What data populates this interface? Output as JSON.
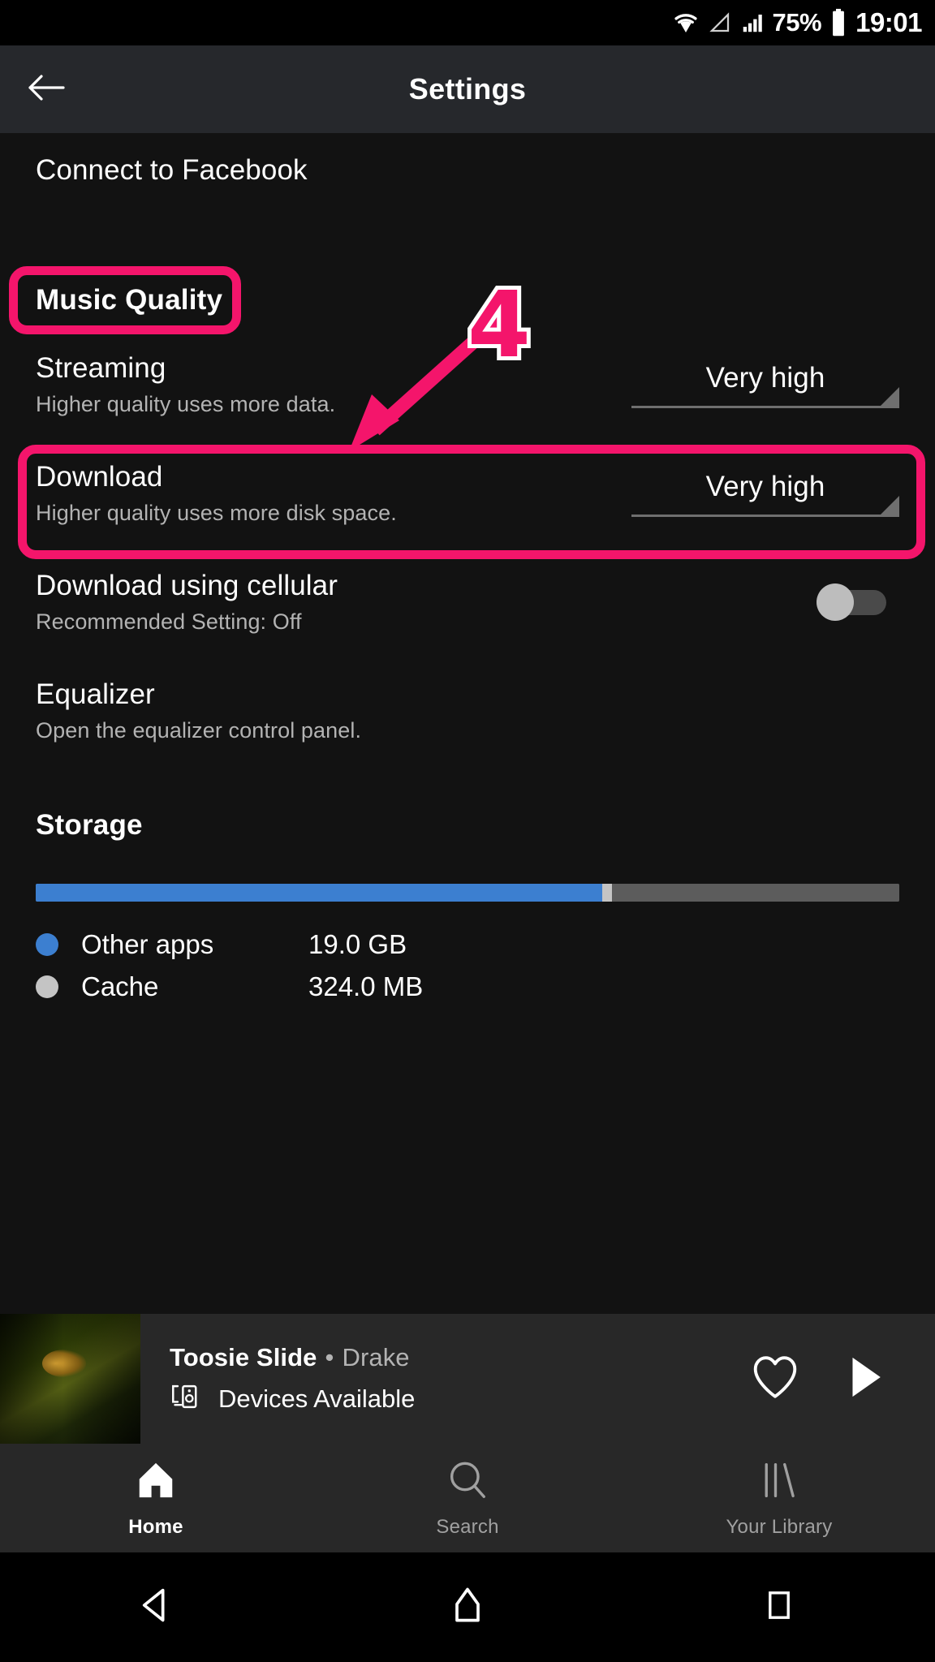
{
  "status_bar": {
    "wifi_icon": "wifi-icon",
    "signal_triangle_icon": "signal-triangle-icon",
    "signal_bars_icon": "signal-bars-icon",
    "battery_percent": "75%",
    "battery_icon": "battery-icon",
    "clock": "19:01"
  },
  "app_bar": {
    "back_icon": "back-arrow-icon",
    "title": "Settings"
  },
  "settings": {
    "facebook": {
      "title": "Connect to Facebook"
    },
    "music_quality_header": "Music Quality",
    "streaming": {
      "title": "Streaming",
      "subtitle": "Higher quality uses more data.",
      "value": "Very high"
    },
    "download": {
      "title": "Download",
      "subtitle": "Higher quality uses more disk space.",
      "value": "Very high"
    },
    "download_cellular": {
      "title": "Download using cellular",
      "subtitle": "Recommended Setting: Off",
      "toggle_state": "off"
    },
    "equalizer": {
      "title": "Equalizer",
      "subtitle": "Open the equalizer control panel."
    },
    "storage_header": "Storage"
  },
  "storage": {
    "bar_segments": [
      {
        "name": "Other apps",
        "percent": 65.6,
        "color": "#3C7FD0"
      },
      {
        "name": "Cache",
        "percent": 1.1,
        "color": "#C4C4C4"
      },
      {
        "name": "Free",
        "percent": 33.3,
        "color": "#5C5C5C"
      }
    ],
    "legend": [
      {
        "label": "Other apps",
        "value": "19.0 GB",
        "color": "#3C7FD0"
      },
      {
        "label": "Cache",
        "value": "324.0 MB",
        "color": "#C4C4C4"
      }
    ]
  },
  "now_playing": {
    "title": "Toosie Slide",
    "separator": "•",
    "artist": "Drake",
    "devices_icon": "devices-available-icon",
    "devices_text": "Devices Available",
    "like_icon": "heart-outline-icon",
    "play_icon": "play-icon"
  },
  "bottom_nav": {
    "items": [
      {
        "label": "Home",
        "icon": "home-icon",
        "active": true
      },
      {
        "label": "Search",
        "icon": "search-icon",
        "active": false
      },
      {
        "label": "Your Library",
        "icon": "library-icon",
        "active": false
      }
    ]
  },
  "android_nav": {
    "back_icon": "android-back-icon",
    "home_icon": "android-home-icon",
    "recents_icon": "android-recents-icon"
  },
  "annotations": {
    "color": "#F4156B",
    "outline_color": "#FFFFFF",
    "step_number": "4",
    "highlight_targets": [
      "Music Quality",
      "Download"
    ]
  }
}
